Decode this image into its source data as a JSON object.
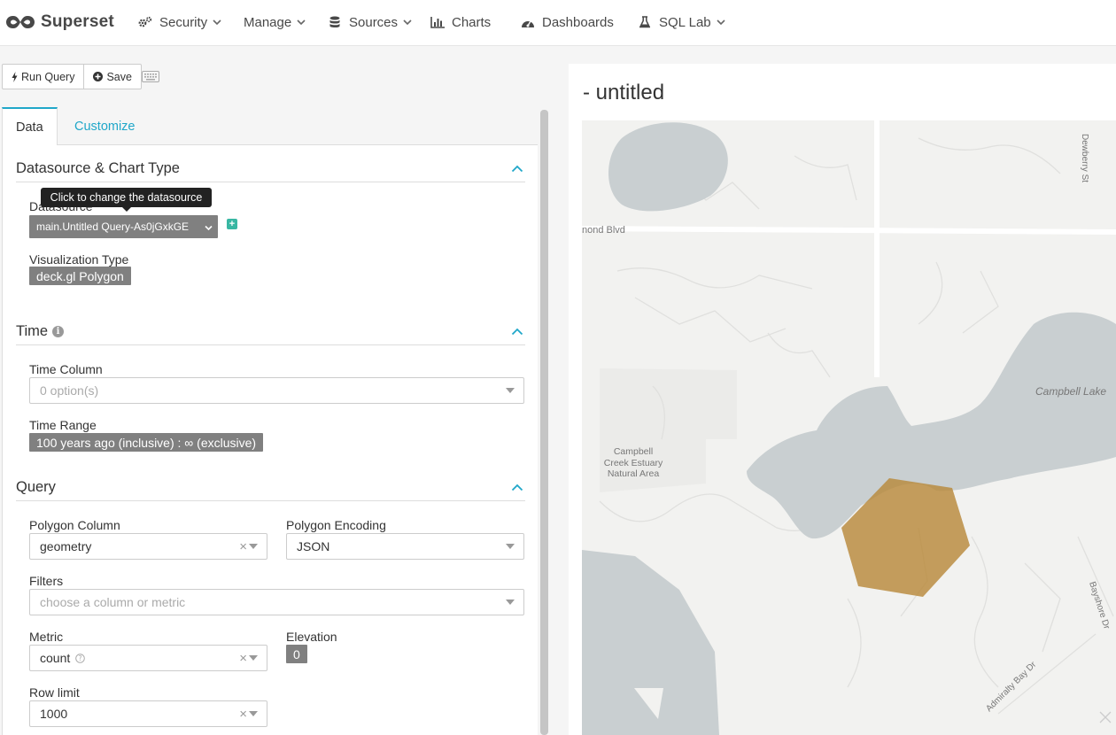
{
  "navbar": {
    "brand": "Superset",
    "items": [
      {
        "label": "Security",
        "icon": "gears-icon",
        "dropdown": true
      },
      {
        "label": "Manage",
        "icon": "",
        "dropdown": true
      },
      {
        "label": "Sources",
        "icon": "database-icon",
        "dropdown": true
      },
      {
        "label": "Charts",
        "icon": "bar-chart-icon",
        "dropdown": false
      },
      {
        "label": "Dashboards",
        "icon": "dashboard-icon",
        "dropdown": false
      },
      {
        "label": "SQL Lab",
        "icon": "flask-icon",
        "dropdown": true
      }
    ]
  },
  "toolbar": {
    "run_query": "Run Query",
    "save": "Save"
  },
  "tabs": {
    "data": "Data",
    "customize": "Customize"
  },
  "sections": {
    "datasource_chart_type": {
      "title": "Datasource & Chart Type",
      "tooltip": "Click to change the datasource",
      "datasource_label": "Datasource",
      "datasource_value": "main.Untitled Query-As0jGxkGE",
      "viz_type_label": "Visualization Type",
      "viz_type_value": "deck.gl Polygon"
    },
    "time": {
      "title": "Time",
      "time_column_label": "Time Column",
      "time_column_placeholder": "0 option(s)",
      "time_range_label": "Time Range",
      "time_range_value": "100 years ago (inclusive) : ∞ (exclusive)"
    },
    "query": {
      "title": "Query",
      "polygon_column_label": "Polygon Column",
      "polygon_column_value": "geometry",
      "polygon_encoding_label": "Polygon Encoding",
      "polygon_encoding_value": "JSON",
      "filters_label": "Filters",
      "filters_placeholder": "choose a column or metric",
      "metric_label": "Metric",
      "metric_value": "count",
      "elevation_label": "Elevation",
      "elevation_value": "0",
      "row_limit_label": "Row limit",
      "row_limit_value": "1000"
    }
  },
  "chart": {
    "title": "- untitled",
    "map_labels": {
      "road1": "nond Blvd",
      "street1": "Dewberry St",
      "lake": "Campbell Lake",
      "park_line1": "Campbell",
      "park_line2": "Creek Estuary",
      "park_line3": "Natural Area",
      "street2": "Bayshore Dr",
      "street3": "Admiralty Bay Dr"
    },
    "polygon_color": "#b8893a"
  },
  "colors": {
    "accent": "#20a7c9",
    "brand": "#484848",
    "tag": "#808080",
    "add_button": "#39b7a3"
  }
}
